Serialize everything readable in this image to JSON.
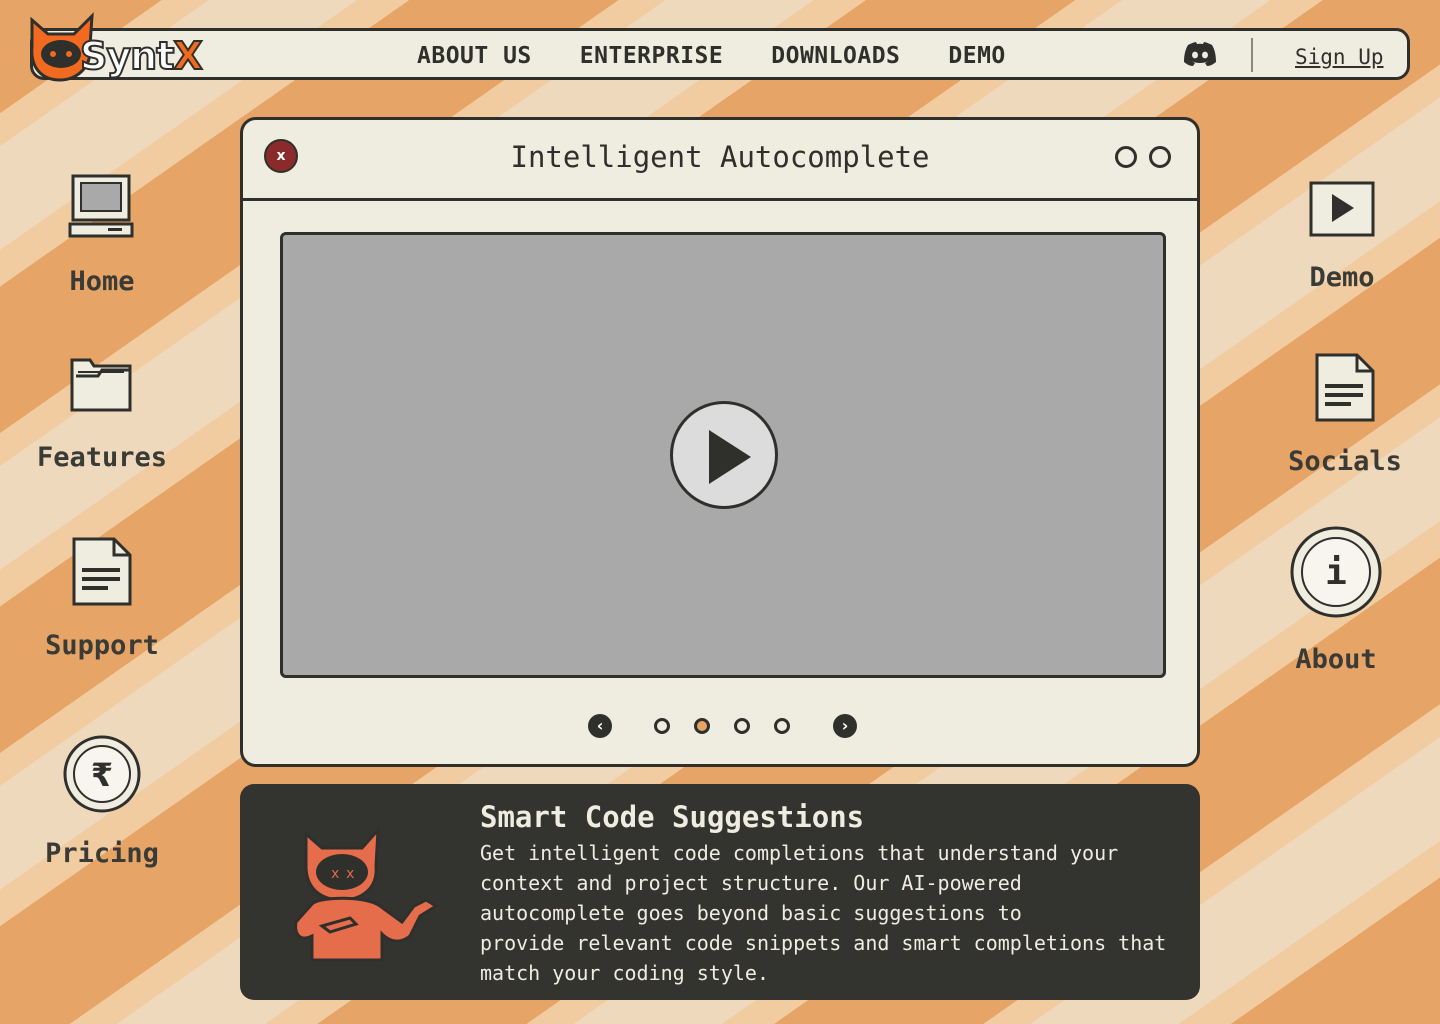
{
  "brand": {
    "name_part1": "Synt",
    "name_part2": "X"
  },
  "nav": {
    "items": [
      "ABOUT US",
      "ENTERPRISE",
      "DOWNLOADS",
      "DEMO"
    ],
    "signup_label": "Sign Up"
  },
  "desktop_left": [
    {
      "label": "Home",
      "icon": "computer-icon"
    },
    {
      "label": "Features",
      "icon": "folder-icon"
    },
    {
      "label": "Support",
      "icon": "document-icon"
    },
    {
      "label": "Pricing",
      "icon": "rupee-coin-icon"
    }
  ],
  "desktop_right": [
    {
      "label": "Demo",
      "icon": "play-window-icon"
    },
    {
      "label": "Socials",
      "icon": "document-icon"
    },
    {
      "label": "About",
      "icon": "info-coin-icon"
    }
  ],
  "window": {
    "close_label": "x",
    "title": "Intelligent Autocomplete",
    "carousel": {
      "total": 4,
      "active_index": 1
    }
  },
  "info": {
    "title": "Smart Code Suggestions",
    "lines": [
      "Get intelligent code completions that understand your",
      "context and project structure. Our AI-powered",
      "autocomplete goes beyond basic suggestions to",
      "provide relevant code snippets and smart completions that",
      "match your coding style."
    ]
  },
  "colors": {
    "accent_orange": "#f26a1f",
    "dark": "#2f2f2c",
    "panel_bg": "#efece0",
    "close_red": "#8b2a2a"
  }
}
